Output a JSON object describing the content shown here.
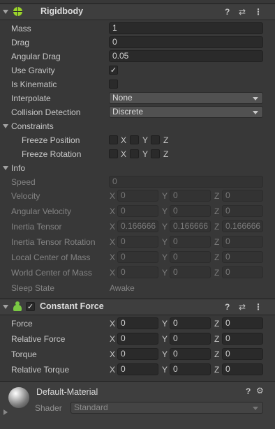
{
  "rigidbody": {
    "title": "Rigidbody",
    "mass_label": "Mass",
    "mass_value": "1",
    "drag_label": "Drag",
    "drag_value": "0",
    "angular_drag_label": "Angular Drag",
    "angular_drag_value": "0.05",
    "use_gravity_label": "Use Gravity",
    "use_gravity_checked": "✓",
    "is_kinematic_label": "Is Kinematic",
    "interpolate_label": "Interpolate",
    "interpolate_value": "None",
    "collision_label": "Collision Detection",
    "collision_value": "Discrete",
    "constraints_label": "Constraints",
    "freeze_position_label": "Freeze Position",
    "freeze_rotation_label": "Freeze Rotation",
    "info_label": "Info",
    "speed_label": "Speed",
    "speed_value": "0",
    "velocity_label": "Velocity",
    "angular_velocity_label": "Angular Velocity",
    "inertia_tensor_label": "Inertia Tensor",
    "inertia_tensor_rotation_label": "Inertia Tensor Rotation",
    "local_com_label": "Local Center of Mass",
    "world_com_label": "World Center of Mass",
    "sleep_state_label": "Sleep State",
    "sleep_state_value": "Awake"
  },
  "axes": {
    "x": "X",
    "y": "Y",
    "z": "Z"
  },
  "info_values": {
    "velocity": [
      "0",
      "0",
      "0"
    ],
    "angular_velocity": [
      "0",
      "0",
      "0"
    ],
    "inertia_tensor": [
      "0.166666",
      "0.166666",
      "0.166666"
    ],
    "inertia_tensor_rotation": [
      "0",
      "0",
      "0"
    ],
    "local_com": [
      "0",
      "0",
      "0"
    ],
    "world_com": [
      "0",
      "0",
      "0"
    ]
  },
  "constant_force": {
    "title": "Constant Force",
    "enabled_check": "✓",
    "force_label": "Force",
    "force": [
      "0",
      "0",
      "0"
    ],
    "relative_force_label": "Relative Force",
    "relative_force": [
      "0",
      "0",
      "0"
    ],
    "torque_label": "Torque",
    "torque": [
      "0",
      "0",
      "0"
    ],
    "relative_torque_label": "Relative Torque",
    "relative_torque": [
      "0",
      "0",
      "0"
    ]
  },
  "material": {
    "name": "Default-Material",
    "shader_label": "Shader",
    "shader_value": "Standard"
  },
  "icons": {
    "help": "?",
    "presets": "⇄",
    "menu": "⋮",
    "settings": "⚙"
  },
  "colors": {
    "accent_check": "#e6e6e6",
    "component_icon": "#7ac943",
    "rigidbody_icon": "#9ad32b"
  }
}
